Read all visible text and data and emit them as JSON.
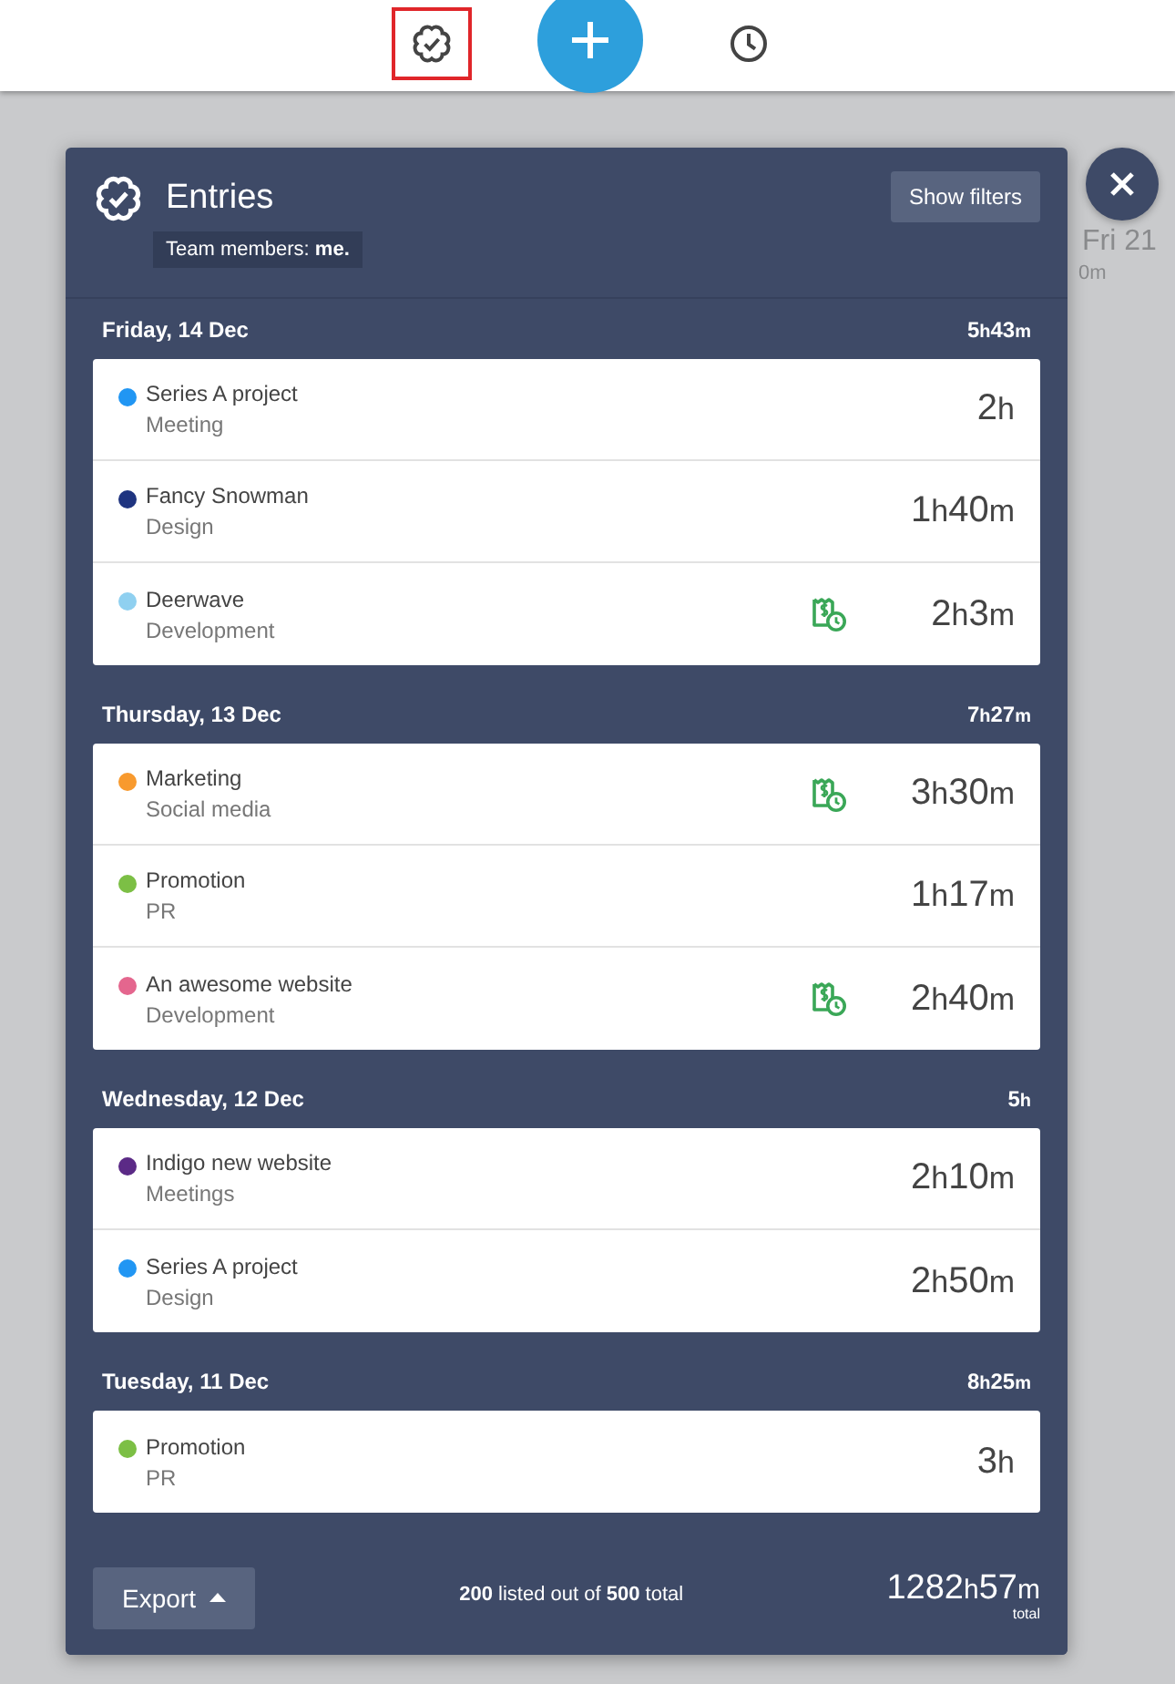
{
  "toolbar": {
    "items": [
      {
        "kind": "entries",
        "highlighted": true
      },
      {
        "kind": "add",
        "highlighted": false
      },
      {
        "kind": "timer",
        "highlighted": false
      }
    ]
  },
  "background": {
    "day": "Fri 21",
    "total": "0m"
  },
  "panel": {
    "title": "Entries",
    "filters_button": "Show filters",
    "team_filter": "Team members: **me.**",
    "days": [
      {
        "date": "Friday, 14 Dec",
        "total": "5h43m",
        "entries": [
          {
            "project": "Series A project",
            "task": "Meeting",
            "color": "#2196f3",
            "billable": false,
            "duration": "2h"
          },
          {
            "project": "Fancy Snowman",
            "task": "Design",
            "color": "#1f3480",
            "billable": false,
            "duration": "1h40m"
          },
          {
            "project": "Deerwave",
            "task": "Development",
            "color": "#8fd0f0",
            "billable": true,
            "duration": "2h3m"
          }
        ]
      },
      {
        "date": "Thursday, 13 Dec",
        "total": "7h27m",
        "entries": [
          {
            "project": "Marketing",
            "task": "Social media",
            "color": "#f89a2e",
            "billable": true,
            "duration": "3h30m"
          },
          {
            "project": "Promotion",
            "task": "PR",
            "color": "#7cbf45",
            "billable": false,
            "duration": "1h17m"
          },
          {
            "project": "An awesome website",
            "task": "Development",
            "color": "#e4668e",
            "billable": true,
            "duration": "2h40m"
          }
        ]
      },
      {
        "date": "Wednesday, 12 Dec",
        "total": "5h",
        "entries": [
          {
            "project": "Indigo new website",
            "task": "Meetings",
            "color": "#5b2a86",
            "billable": false,
            "duration": "2h10m"
          },
          {
            "project": "Series A project",
            "task": "Design",
            "color": "#2196f3",
            "billable": false,
            "duration": "2h50m"
          }
        ]
      },
      {
        "date": "Tuesday, 11 Dec",
        "total": "8h25m",
        "entries": [
          {
            "project": "Promotion",
            "task": "PR",
            "color": "#7cbf45",
            "billable": false,
            "duration": "3h"
          }
        ]
      }
    ],
    "footer": {
      "export_button": "Export",
      "summary": "**200** listed out of **500** total",
      "grand_total": "1282h57m",
      "grand_total_label": "total"
    }
  }
}
